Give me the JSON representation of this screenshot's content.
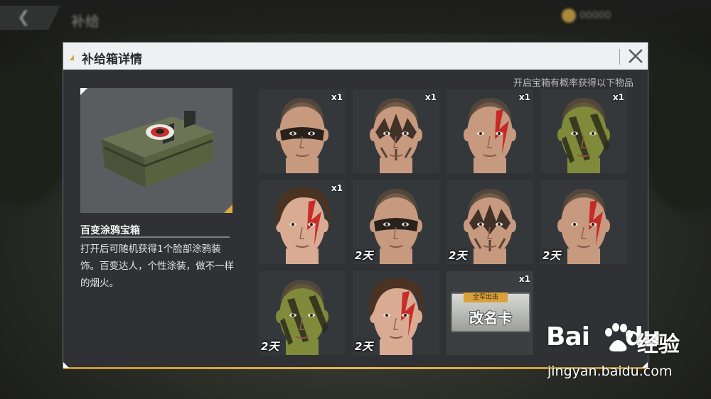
{
  "background": {
    "page_title": "补给",
    "currency_text": "00000"
  },
  "dialog": {
    "title": "补给箱详情",
    "hint": "开启宝箱有概率获得以下物品"
  },
  "item": {
    "name": "百变涂鸦宝箱",
    "description": "打开后可随机获得1个脸部涂鸦装饰。百变达人，个性涂装，做不一样的烟火。"
  },
  "rewards": [
    {
      "paint": "black-eyes",
      "gender": "male",
      "qty": "x1",
      "duration": ""
    },
    {
      "paint": "tribal",
      "gender": "male",
      "qty": "x1",
      "duration": ""
    },
    {
      "paint": "red-slash",
      "gender": "male",
      "qty": "x1",
      "duration": ""
    },
    {
      "paint": "camo",
      "gender": "male",
      "qty": "x1",
      "duration": ""
    },
    {
      "paint": "red-slash",
      "gender": "female",
      "qty": "x1",
      "duration": ""
    },
    {
      "paint": "black-eyes",
      "gender": "male",
      "qty": "",
      "duration": "2天"
    },
    {
      "paint": "tribal",
      "gender": "male",
      "qty": "",
      "duration": "2天"
    },
    {
      "paint": "red-slash",
      "gender": "male",
      "qty": "",
      "duration": "2天"
    },
    {
      "paint": "camo",
      "gender": "male",
      "qty": "",
      "duration": "2天"
    },
    {
      "paint": "red-slash",
      "gender": "female",
      "qty": "",
      "duration": "2天"
    }
  ],
  "rename_card": {
    "tag": "全军出击",
    "label": "改名卡",
    "qty": "x1"
  },
  "watermark": {
    "logo": "Bai",
    "logo2": "du",
    "cn": "经验",
    "url": "jingyan.baidu.com"
  },
  "colors": {
    "accent_gold": "#e0aa3e",
    "panel": "#2f3134",
    "header": "#eef0f2"
  }
}
